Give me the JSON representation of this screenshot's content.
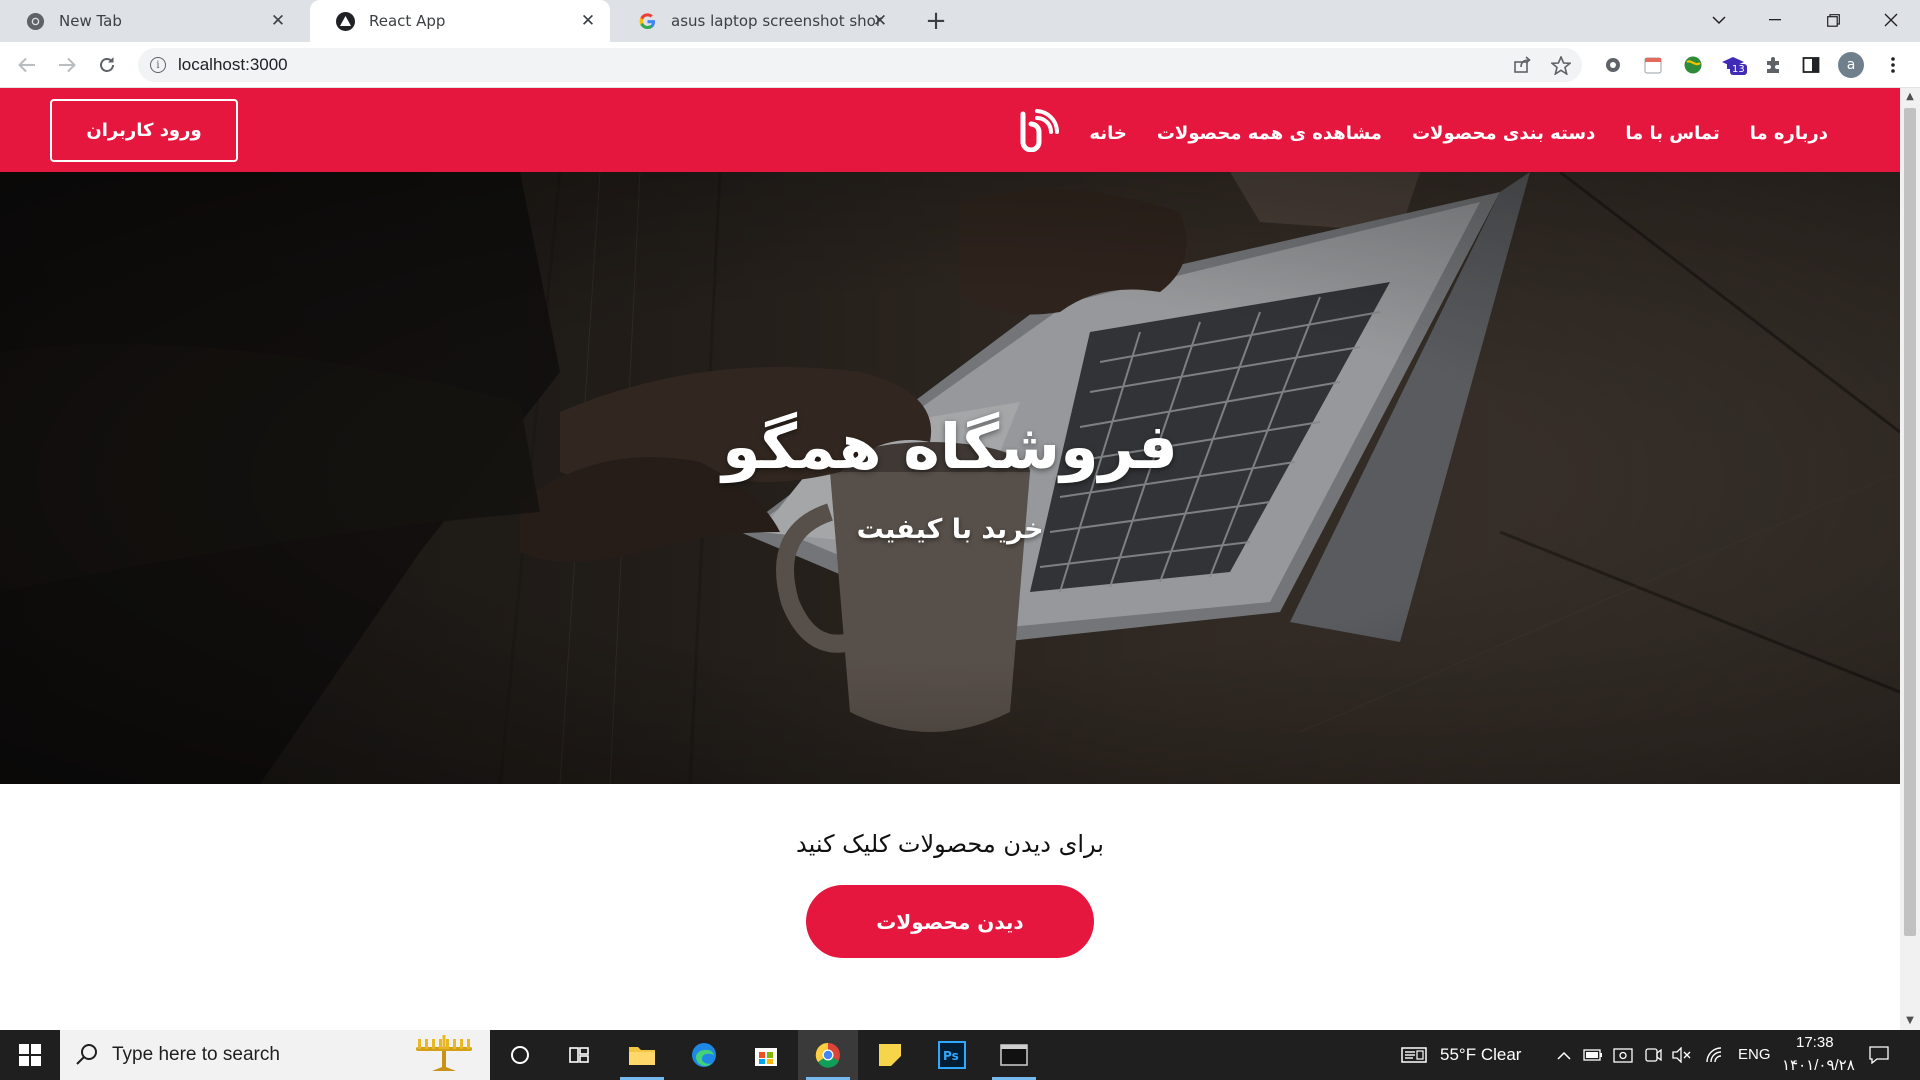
{
  "browser": {
    "tabs": [
      {
        "title": "New Tab",
        "favicon": "chrome-icon"
      },
      {
        "title": "React App",
        "favicon": "react-app-icon",
        "active": true
      },
      {
        "title": "asus laptop screenshot shortcut -",
        "favicon": "google-icon"
      }
    ],
    "new_tab_label": "+",
    "close_glyph": "✕",
    "url": "localhost:3000",
    "profile_initial": "a",
    "extension_badge": "13"
  },
  "site": {
    "brand_color": "#e5173f",
    "login_label": "ورود کاربران",
    "menu": [
      {
        "label": "خانه"
      },
      {
        "label": "مشاهده ی همه محصولات"
      },
      {
        "label": "دسته بندی محصولات"
      },
      {
        "label": "تماس با ما"
      },
      {
        "label": "درباره ما"
      }
    ],
    "hero": {
      "title": "فروشگاه همگو",
      "subtitle": "خرید با کیفیت"
    },
    "cta": {
      "text": "برای دیدن محصولات کلیک کنید",
      "button_label": "دیدن محصولات"
    }
  },
  "taskbar": {
    "search_placeholder": "Type here to search",
    "weather": "55°F  Clear",
    "language": "ENG",
    "time": "17:38",
    "date": "۱۴۰۱/۰۹/۲۸"
  }
}
